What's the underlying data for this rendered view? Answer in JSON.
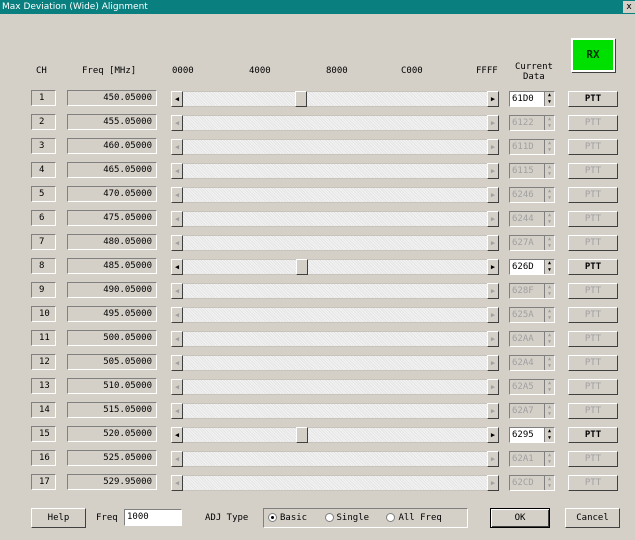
{
  "window": {
    "title": "Max Deviation (Wide) Alignment",
    "close": "x"
  },
  "rx_label": "RX",
  "headers": {
    "ch": "CH",
    "freq": "Freq [MHz]",
    "tick0": "0000",
    "tick1": "4000",
    "tick2": "8000",
    "tick3": "C000",
    "tick4": "FFFF",
    "current1": "Current",
    "current2": "Data"
  },
  "rows": [
    {
      "ch": "1",
      "freq": "450.05000",
      "data": "61D0",
      "ptt": "PTT",
      "enabled": true,
      "value": 25040
    },
    {
      "ch": "2",
      "freq": "455.05000",
      "data": "6122",
      "ptt": "PTT",
      "enabled": false
    },
    {
      "ch": "3",
      "freq": "460.05000",
      "data": "611D",
      "ptt": "PTT",
      "enabled": false
    },
    {
      "ch": "4",
      "freq": "465.05000",
      "data": "6115",
      "ptt": "PTT",
      "enabled": false
    },
    {
      "ch": "5",
      "freq": "470.05000",
      "data": "6246",
      "ptt": "PTT",
      "enabled": false
    },
    {
      "ch": "6",
      "freq": "475.05000",
      "data": "6244",
      "ptt": "PTT",
      "enabled": false
    },
    {
      "ch": "7",
      "freq": "480.05000",
      "data": "627A",
      "ptt": "PTT",
      "enabled": false
    },
    {
      "ch": "8",
      "freq": "485.05000",
      "data": "626D",
      "ptt": "PTT",
      "enabled": true,
      "value": 25197
    },
    {
      "ch": "9",
      "freq": "490.05000",
      "data": "628F",
      "ptt": "PTT",
      "enabled": false
    },
    {
      "ch": "10",
      "freq": "495.05000",
      "data": "625A",
      "ptt": "PTT",
      "enabled": false
    },
    {
      "ch": "11",
      "freq": "500.05000",
      "data": "62AA",
      "ptt": "PTT",
      "enabled": false
    },
    {
      "ch": "12",
      "freq": "505.05000",
      "data": "62A4",
      "ptt": "PTT",
      "enabled": false
    },
    {
      "ch": "13",
      "freq": "510.05000",
      "data": "62A5",
      "ptt": "PTT",
      "enabled": false
    },
    {
      "ch": "14",
      "freq": "515.05000",
      "data": "62A7",
      "ptt": "PTT",
      "enabled": false
    },
    {
      "ch": "15",
      "freq": "520.05000",
      "data": "6295",
      "ptt": "PTT",
      "enabled": true,
      "value": 25237
    },
    {
      "ch": "16",
      "freq": "525.05000",
      "data": "62A1",
      "ptt": "PTT",
      "enabled": false
    },
    {
      "ch": "17",
      "freq": "529.95000",
      "data": "62CD",
      "ptt": "PTT",
      "enabled": false
    }
  ],
  "bottom": {
    "help": "Help",
    "freq_label": "Freq",
    "freq_value": "1000",
    "adj_label": "ADJ Type",
    "opt_basic": "Basic",
    "opt_single": "Single",
    "opt_all": "All Freq",
    "ok": "OK",
    "cancel": "Cancel"
  }
}
